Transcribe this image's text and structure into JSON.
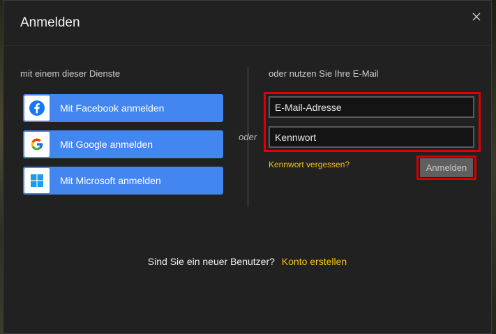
{
  "dialog": {
    "title": "Anmelden",
    "close_label": "×"
  },
  "left": {
    "heading": "mit einem dieser Dienste",
    "buttons": [
      {
        "label": "Mit Facebook anmelden",
        "icon": "facebook-icon"
      },
      {
        "label": "Mit Google anmelden",
        "icon": "google-icon"
      },
      {
        "label": "Mit Microsoft anmelden",
        "icon": "windows-icon"
      }
    ]
  },
  "divider": {
    "label": "oder"
  },
  "right": {
    "heading": "oder nutzen Sie Ihre E-Mail",
    "email_placeholder": "E-Mail-Adresse",
    "password_placeholder": "Kennwort",
    "forgot_label": "Kennwort vergessen?",
    "login_label": "Anmelden"
  },
  "footer": {
    "question": "Sind Sie ein neuer Benutzer?",
    "create_label": "Konto erstellen"
  },
  "colors": {
    "dialog_bg": "#212121",
    "social_button": "#4486ef",
    "link_yellow": "#f5c20f",
    "highlight_red": "#e00000"
  }
}
